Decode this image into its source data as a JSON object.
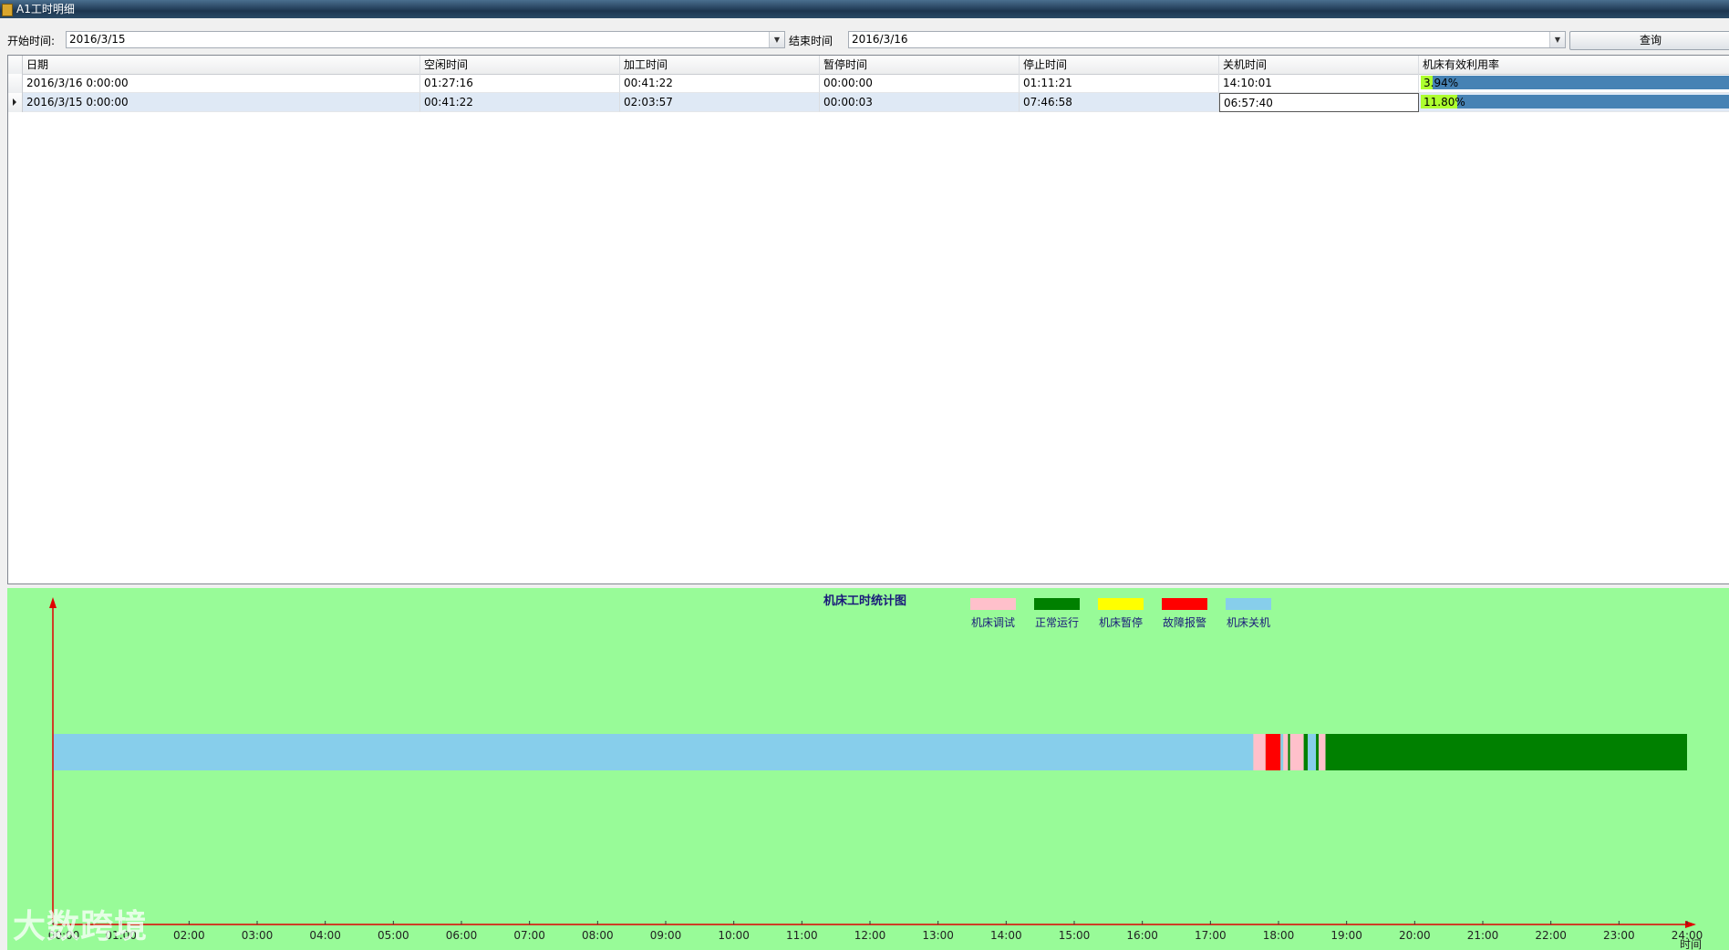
{
  "window": {
    "title": "A1工时明细"
  },
  "query": {
    "start_label": "开始时间:",
    "start_value": "2016/3/15",
    "end_label": "结束时间",
    "end_value": "2016/3/16",
    "query_button": "查询"
  },
  "grid": {
    "columns": [
      "日期",
      "空闲时间",
      "加工时间",
      "暂停时间",
      "停止时间",
      "关机时间",
      "机床有效利用率"
    ],
    "rows": [
      {
        "date": "2016/3/16 0:00:00",
        "idle": "01:27:16",
        "process": "00:41:22",
        "pause": "00:00:00",
        "stop": "01:11:21",
        "off": "14:10:01",
        "util_text": "3.94%",
        "util": 3.94,
        "selected": false
      },
      {
        "date": "2016/3/15 0:00:00",
        "idle": "00:41:22",
        "process": "02:03:57",
        "pause": "00:00:03",
        "stop": "07:46:58",
        "off": "06:57:40",
        "util_text": "11.80%",
        "util": 11.8,
        "selected": true
      }
    ]
  },
  "chart_data": {
    "type": "timeline",
    "title": "机床工时统计图",
    "xlabel": "时间",
    "x_ticks": [
      "00:00",
      "01:00",
      "02:00",
      "03:00",
      "04:00",
      "05:00",
      "06:00",
      "07:00",
      "08:00",
      "09:00",
      "10:00",
      "11:00",
      "12:00",
      "13:00",
      "14:00",
      "15:00",
      "16:00",
      "17:00",
      "18:00",
      "19:00",
      "20:00",
      "21:00",
      "22:00",
      "23:00",
      "24:00"
    ],
    "xlim": [
      0,
      24
    ],
    "legend": [
      {
        "name": "机床调试",
        "color": "#ffc0cb"
      },
      {
        "name": "正常运行",
        "color": "#008000"
      },
      {
        "name": "机床暂停",
        "color": "#ffff00"
      },
      {
        "name": "故障报警",
        "color": "#ff0000"
      },
      {
        "name": "机床关机",
        "color": "#87ceeb"
      }
    ],
    "segments": [
      {
        "state": "机床关机",
        "start": 0.0,
        "end": 17.63,
        "color": "#87ceeb"
      },
      {
        "state": "机床调试",
        "start": 17.63,
        "end": 17.81,
        "color": "#ffc0cb"
      },
      {
        "state": "故障报警",
        "start": 17.81,
        "end": 18.03,
        "color": "#ff0000"
      },
      {
        "state": "机床关机",
        "start": 18.03,
        "end": 18.07,
        "color": "#87ceeb"
      },
      {
        "state": "机床调试",
        "start": 18.07,
        "end": 18.14,
        "color": "#ffc0cb"
      },
      {
        "state": "正常运行",
        "start": 18.14,
        "end": 18.17,
        "color": "#008000"
      },
      {
        "state": "机床调试",
        "start": 18.17,
        "end": 18.37,
        "color": "#ffc0cb"
      },
      {
        "state": "正常运行",
        "start": 18.37,
        "end": 18.43,
        "color": "#008000"
      },
      {
        "state": "机床关机",
        "start": 18.43,
        "end": 18.55,
        "color": "#87ceeb"
      },
      {
        "state": "正常运行",
        "start": 18.55,
        "end": 18.59,
        "color": "#008000"
      },
      {
        "state": "机床调试",
        "start": 18.59,
        "end": 18.69,
        "color": "#ffc0cb"
      },
      {
        "state": "正常运行",
        "start": 18.69,
        "end": 24.0,
        "color": "#008000"
      }
    ]
  },
  "watermark": "大数跨境"
}
